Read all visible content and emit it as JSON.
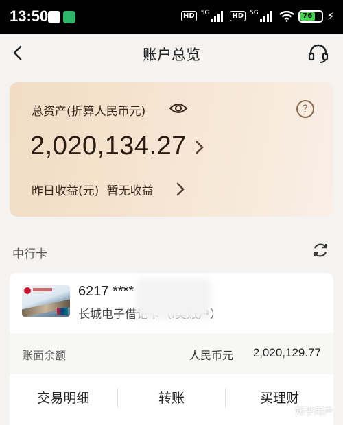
{
  "status_bar": {
    "time": "13:50",
    "hd1": "HD",
    "net1": "5G",
    "hd2": "HD",
    "net2": "5G",
    "battery": "76"
  },
  "nav": {
    "title": "账户总览",
    "back_icon": "chevron-left-icon",
    "support_icon": "headset-icon"
  },
  "asset": {
    "label": "总资产(折算人民币元)",
    "amount": "2,020,134.27",
    "income_label": "昨日收益(元)",
    "income_value": "暂无收益"
  },
  "section": {
    "title": "中行卡"
  },
  "card": {
    "number": "6217 ****",
    "name": "长城电子借记卡（I类账户）",
    "balance_label": "账面余额",
    "balance_currency": "人民币元",
    "balance_value": "2,020,129.77"
  },
  "actions": [
    "交易明细",
    "转账",
    "买理财"
  ],
  "watermark": "知乎用户",
  "colors": {
    "card_gradient_start": "#f2dcc4",
    "card_gradient_end": "#f9efe6",
    "accent_brown": "#8a6a50",
    "page_bg": "#f4f3f1"
  }
}
